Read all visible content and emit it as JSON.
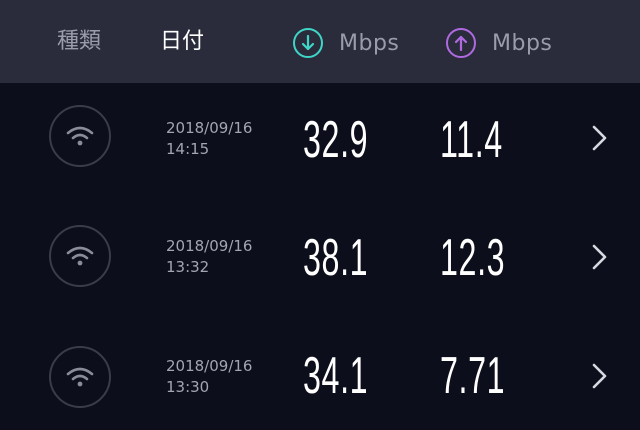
{
  "header": {
    "type_label": "種類",
    "date_label": "日付",
    "download_unit": "Mbps",
    "upload_unit": "Mbps",
    "download_icon": "arrow-down-circle-icon",
    "upload_icon": "arrow-up-circle-icon",
    "download_color": "#3fd6c8",
    "upload_color": "#b06ae0"
  },
  "rows": [
    {
      "date": "2018/09/16",
      "time": "14:15",
      "download": "32.9",
      "upload": "11.4",
      "type_icon": "wifi-icon"
    },
    {
      "date": "2018/09/16",
      "time": "13:32",
      "download": "38.1",
      "upload": "12.3",
      "type_icon": "wifi-icon"
    },
    {
      "date": "2018/09/16",
      "time": "13:30",
      "download": "34.1",
      "upload": "7.71",
      "type_icon": "wifi-icon"
    }
  ]
}
